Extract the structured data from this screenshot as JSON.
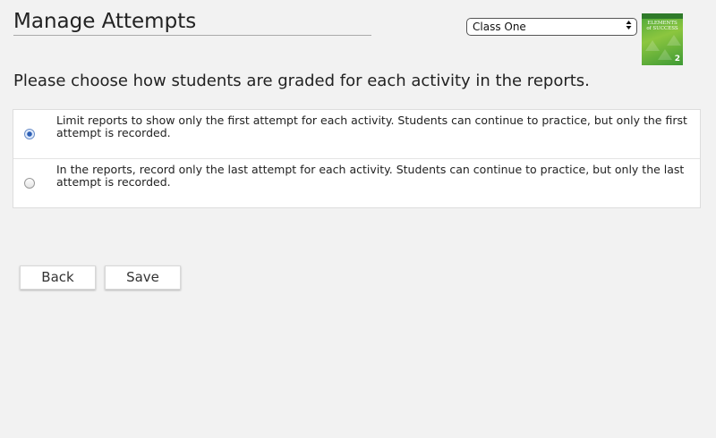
{
  "header": {
    "title": "Manage Attempts",
    "class_select": {
      "selected": "Class One",
      "arrow_icon": "updown-arrows-icon"
    },
    "book_cover": {
      "title_line1": "ELEMENTS",
      "title_line2": "of SUCCESS",
      "number": "2"
    }
  },
  "main": {
    "instruction": "Please choose how students are graded for each activity in the reports.",
    "options": [
      {
        "label": "Limit reports to show only the first attempt for each activity. Students can continue to practice, but only the first attempt is recorded.",
        "selected": true
      },
      {
        "label": "In the reports, record only the last attempt for each activity. Students can continue to practice, but only the last attempt is recorded.",
        "selected": false
      }
    ]
  },
  "footer": {
    "back_label": "Back",
    "save_label": "Save"
  },
  "colors": {
    "background": "#f2f2f2",
    "panel": "#ffffff",
    "radio_selected": "#2d5fb5",
    "book_green": "#4aa63a"
  }
}
